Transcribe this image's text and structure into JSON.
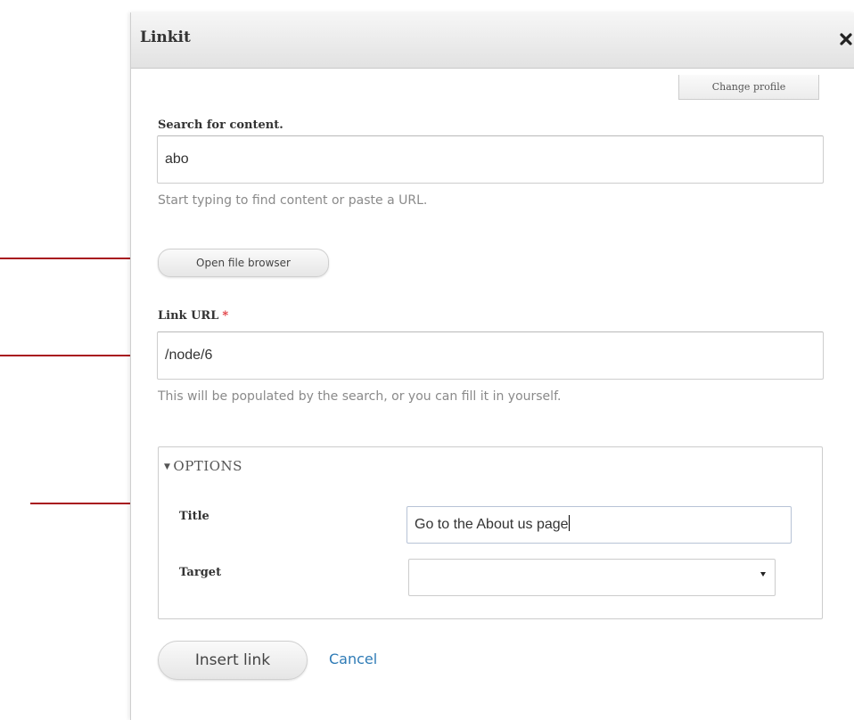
{
  "dialog": {
    "title": "Linkit",
    "close_icon": "close-x-icon",
    "change_profile_label": "Change profile"
  },
  "search": {
    "label": "Search for content.",
    "value": "abo",
    "description": "Start typing to find content or paste a URL."
  },
  "file_browser": {
    "button_label": "Open file browser"
  },
  "link_url": {
    "label": "Link URL",
    "required_marker": "*",
    "value": "/node/6",
    "description": "This will be populated by the search, or you can fill it in yourself."
  },
  "options": {
    "legend": "OPTIONS",
    "expanded": true,
    "title_label": "Title",
    "title_value": "Go to the About us page",
    "target_label": "Target",
    "target_value": ""
  },
  "actions": {
    "insert_label": "Insert link",
    "cancel_label": "Cancel"
  },
  "annotations": {
    "arrow_color": "#a8141e",
    "arrow_icon": "red-pointer-arrow-icon"
  },
  "colors": {
    "link": "#2e7bb6",
    "required": "#e0373b",
    "description_text": "#8a8a8a"
  }
}
